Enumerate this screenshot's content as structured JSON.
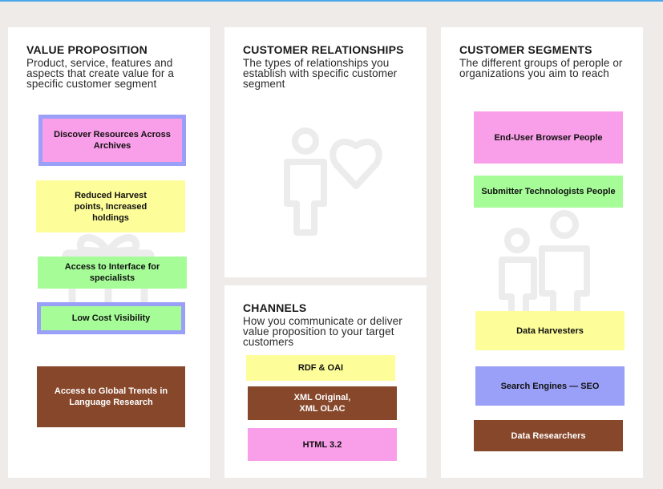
{
  "colors": {
    "pink": "#f99ee8",
    "yellow": "#fdfd9a",
    "green": "#a6fd98",
    "brown": "#86472b",
    "periwinkle": "#9aa0f8",
    "selection_border": "#9aa0f8",
    "panel": "#ffffff",
    "background": "#efebe9"
  },
  "value_proposition": {
    "title": "VALUE PROPOSITION",
    "description": "Product, service, features and aspects that create value for a specific customer segment",
    "watermark_icon": "gift-icon",
    "notes": [
      {
        "text": "Discover Resources Across Archives",
        "color": "pink",
        "selected": true
      },
      {
        "text": "Reduced Harvest points, Increased holdings",
        "color": "yellow",
        "selected": false
      },
      {
        "text": "Access to Interface for specialists",
        "color": "green",
        "selected": false
      },
      {
        "text": "Low Cost Visibility",
        "color": "green",
        "selected": true
      },
      {
        "text": "Access to Global Trends in Language Research",
        "color": "brown",
        "selected": false
      }
    ]
  },
  "customer_relationships": {
    "title": "CUSTOMER RELATIONSHIPS",
    "description": "The types of relationships you establish with specific customer segment",
    "watermark_icon": "person-heart-icon"
  },
  "channels": {
    "title": "CHANNELS",
    "description": "How you communicate or deliver value proposition to your target customers",
    "notes": [
      {
        "text": "RDF & OAI",
        "color": "yellow"
      },
      {
        "text": "XML Original, XML OLAC",
        "color": "brown"
      },
      {
        "text": "HTML 3.2",
        "color": "pink"
      }
    ]
  },
  "customer_segments": {
    "title": "CUSTOMER SEGMENTS",
    "description": "The different groups of perople or organizations you aim to reach",
    "watermark_icon": "people-icon",
    "notes": [
      {
        "text": "End-User Browser People",
        "color": "pink"
      },
      {
        "text": "Submitter Technologists People",
        "color": "green"
      },
      {
        "text": "Data Harvesters",
        "color": "yellow"
      },
      {
        "text": "Search Engines — SEO",
        "color": "periwinkle"
      },
      {
        "text": "Data Researchers",
        "color": "brown"
      }
    ]
  }
}
